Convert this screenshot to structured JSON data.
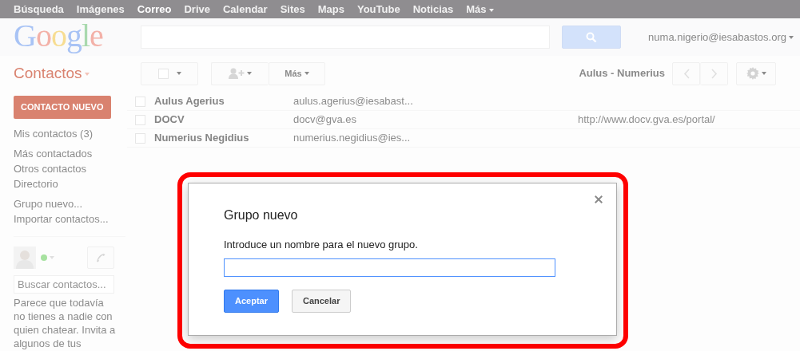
{
  "top_nav": [
    {
      "label": "Búsqueda",
      "selected": false,
      "has_menu": false
    },
    {
      "label": "Imágenes",
      "selected": false,
      "has_menu": false
    },
    {
      "label": "Correo",
      "selected": true,
      "has_menu": false
    },
    {
      "label": "Drive",
      "selected": false,
      "has_menu": false
    },
    {
      "label": "Calendar",
      "selected": false,
      "has_menu": false
    },
    {
      "label": "Sites",
      "selected": false,
      "has_menu": false
    },
    {
      "label": "Maps",
      "selected": false,
      "has_menu": false
    },
    {
      "label": "YouTube",
      "selected": false,
      "has_menu": false
    },
    {
      "label": "Noticias",
      "selected": false,
      "has_menu": false
    },
    {
      "label": "Más",
      "selected": false,
      "has_menu": true
    }
  ],
  "header": {
    "logo": "Google",
    "account": "numa.nigerio@iesabastos.org"
  },
  "toolbar": {
    "title": "Contactos",
    "more_label": "Más",
    "range": "Aulus - Numerius"
  },
  "sidebar": {
    "new_button": "CONTACTO NUEVO",
    "groups": [
      [
        {
          "label": "Mis contactos (3)"
        }
      ],
      [
        {
          "label": "Más contactados"
        },
        {
          "label": "Otros contactos"
        },
        {
          "label": "Directorio"
        }
      ],
      [
        {
          "label": "Grupo nuevo..."
        },
        {
          "label": "Importar contactos..."
        }
      ]
    ],
    "chat": {
      "online": true,
      "search_placeholder": "Buscar contactos...",
      "message": "Parece que todavía no tienes a nadie con quien chatear. Invita a algunos de tus"
    }
  },
  "contacts": [
    {
      "name": "Aulus Agerius",
      "email": "aulus.agerius@iesabast...",
      "checked": false
    },
    {
      "name": "DOCV",
      "email": "docv@gva.es",
      "url": "http://www.docv.gva.es/portal/",
      "checked": false
    },
    {
      "name": "Numerius Negidius",
      "email": "numerius.negidius@ies...",
      "checked": false
    }
  ],
  "dialog": {
    "title": "Grupo nuevo",
    "prompt": "Introduce un nombre para el nuevo grupo.",
    "buttons": [
      {
        "label": "Aceptar",
        "kind": "primary"
      },
      {
        "label": "Cancelar",
        "kind": "default"
      }
    ]
  }
}
